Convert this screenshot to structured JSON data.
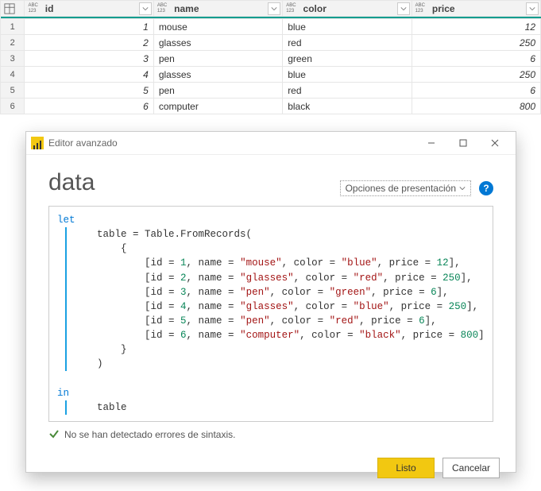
{
  "table": {
    "columns": [
      {
        "key": "id",
        "label": "id"
      },
      {
        "key": "name",
        "label": "name"
      },
      {
        "key": "color",
        "label": "color"
      },
      {
        "key": "price",
        "label": "price"
      }
    ],
    "rows": [
      {
        "n": "1",
        "id": "1",
        "name": "mouse",
        "color": "blue",
        "price": "12"
      },
      {
        "n": "2",
        "id": "2",
        "name": "glasses",
        "color": "red",
        "price": "250"
      },
      {
        "n": "3",
        "id": "3",
        "name": "pen",
        "color": "green",
        "price": "6"
      },
      {
        "n": "4",
        "id": "4",
        "name": "glasses",
        "color": "blue",
        "price": "250"
      },
      {
        "n": "5",
        "id": "5",
        "name": "pen",
        "color": "red",
        "price": "6"
      },
      {
        "n": "6",
        "id": "6",
        "name": "computer",
        "color": "black",
        "price": "800"
      }
    ]
  },
  "dialog": {
    "title": "Editor avanzado",
    "query_name": "data",
    "display_options": "Opciones de presentación",
    "status": "No se han detectado errores de sintaxis.",
    "done": "Listo",
    "cancel": "Cancelar",
    "code": {
      "let": "let",
      "assign": "    table = Table.FromRecords(",
      "open": "        {",
      "r1a": "            [id = ",
      "r1id": "1",
      "r1b": ", name = ",
      "r1name": "\"mouse\"",
      "r1c": ", color = ",
      "r1color": "\"blue\"",
      "r1d": ", price = ",
      "r1price": "12",
      "r1e": "],",
      "r2a": "            [id = ",
      "r2id": "2",
      "r2b": ", name = ",
      "r2name": "\"glasses\"",
      "r2c": ", color = ",
      "r2color": "\"red\"",
      "r2d": ", price = ",
      "r2price": "250",
      "r2e": "],",
      "r3a": "            [id = ",
      "r3id": "3",
      "r3b": ", name = ",
      "r3name": "\"pen\"",
      "r3c": ", color = ",
      "r3color": "\"green\"",
      "r3d": ", price = ",
      "r3price": "6",
      "r3e": "],",
      "r4a": "            [id = ",
      "r4id": "4",
      "r4b": ", name = ",
      "r4name": "\"glasses\"",
      "r4c": ", color = ",
      "r4color": "\"blue\"",
      "r4d": ", price = ",
      "r4price": "250",
      "r4e": "],",
      "r5a": "            [id = ",
      "r5id": "5",
      "r5b": ", name = ",
      "r5name": "\"pen\"",
      "r5c": ", color = ",
      "r5color": "\"red\"",
      "r5d": ", price = ",
      "r5price": "6",
      "r5e": "],",
      "r6a": "            [id = ",
      "r6id": "6",
      "r6b": ", name = ",
      "r6name": "\"computer\"",
      "r6c": ", color = ",
      "r6color": "\"black\"",
      "r6d": ", price = ",
      "r6price": "800",
      "r6e": "]",
      "close": "        }",
      "paren": "    )",
      "in": "in",
      "result": "    table"
    }
  }
}
